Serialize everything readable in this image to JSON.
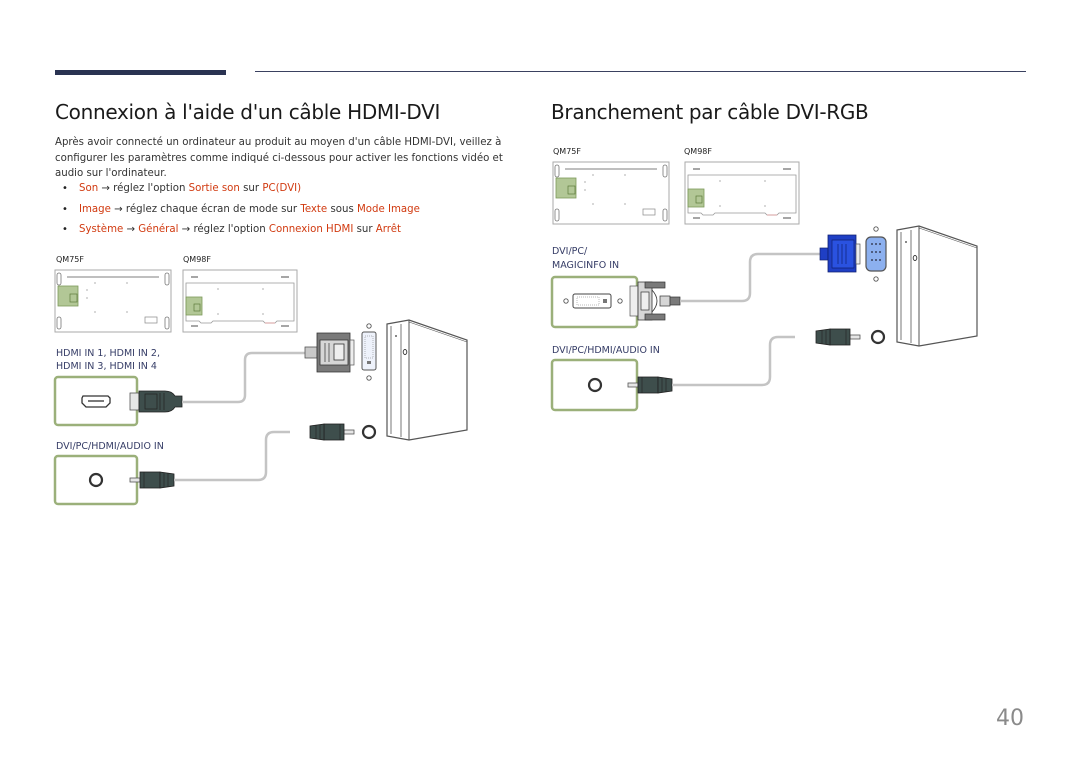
{
  "page_number": "40",
  "left_section": {
    "title": "Connexion à l'aide d'un câble HDMI-DVI",
    "intro": "Après avoir connecté un ordinateur au produit au moyen d'un câble HDMI-DVI, veillez à configurer les paramètres comme indiqué ci-dessous pour activer les fonctions vidéo et audio sur l'ordinateur.",
    "bullets": [
      {
        "parts": [
          {
            "text": "Son",
            "highlight": true
          },
          {
            "text": " → réglez l'option ",
            "highlight": false
          },
          {
            "text": "Sortie son",
            "highlight": true
          },
          {
            "text": " sur ",
            "highlight": false
          },
          {
            "text": "PC(DVI)",
            "highlight": true
          }
        ]
      },
      {
        "parts": [
          {
            "text": "Image",
            "highlight": true
          },
          {
            "text": " → réglez chaque écran de mode sur ",
            "highlight": false
          },
          {
            "text": "Texte",
            "highlight": true
          },
          {
            "text": " sous ",
            "highlight": false
          },
          {
            "text": "Mode Image",
            "highlight": true
          }
        ]
      },
      {
        "parts": [
          {
            "text": "Système",
            "highlight": true
          },
          {
            "text": " → ",
            "highlight": false
          },
          {
            "text": "Général",
            "highlight": true
          },
          {
            "text": " → réglez l'option ",
            "highlight": false
          },
          {
            "text": "Connexion HDMI",
            "highlight": true
          },
          {
            "text": " sur ",
            "highlight": false
          },
          {
            "text": "Arrêt",
            "highlight": true
          }
        ]
      }
    ],
    "models": [
      "QM75F",
      "QM98F"
    ],
    "port_hdmi_line1": "HDMI IN 1, HDMI IN 2,",
    "port_hdmi_line2": "HDMI IN 3, HDMI IN 4",
    "port_audio": "DVI/PC/HDMI/AUDIO IN"
  },
  "right_section": {
    "title": "Branchement par câble DVI-RGB",
    "models": [
      "QM75F",
      "QM98F"
    ],
    "port_dvi_line1": "DVI/PC/",
    "port_dvi_line2": "MAGICINFO IN",
    "port_audio": "DVI/PC/HDMI/AUDIO IN"
  },
  "colors": {
    "highlight": "#d13a10",
    "port_label": "#353c66",
    "port_box_border": "#9bb07a",
    "connector_dark": "#3e4e4c",
    "vga_blue": "#1f3fc4",
    "port_highlight_green": "#8fae6a"
  }
}
